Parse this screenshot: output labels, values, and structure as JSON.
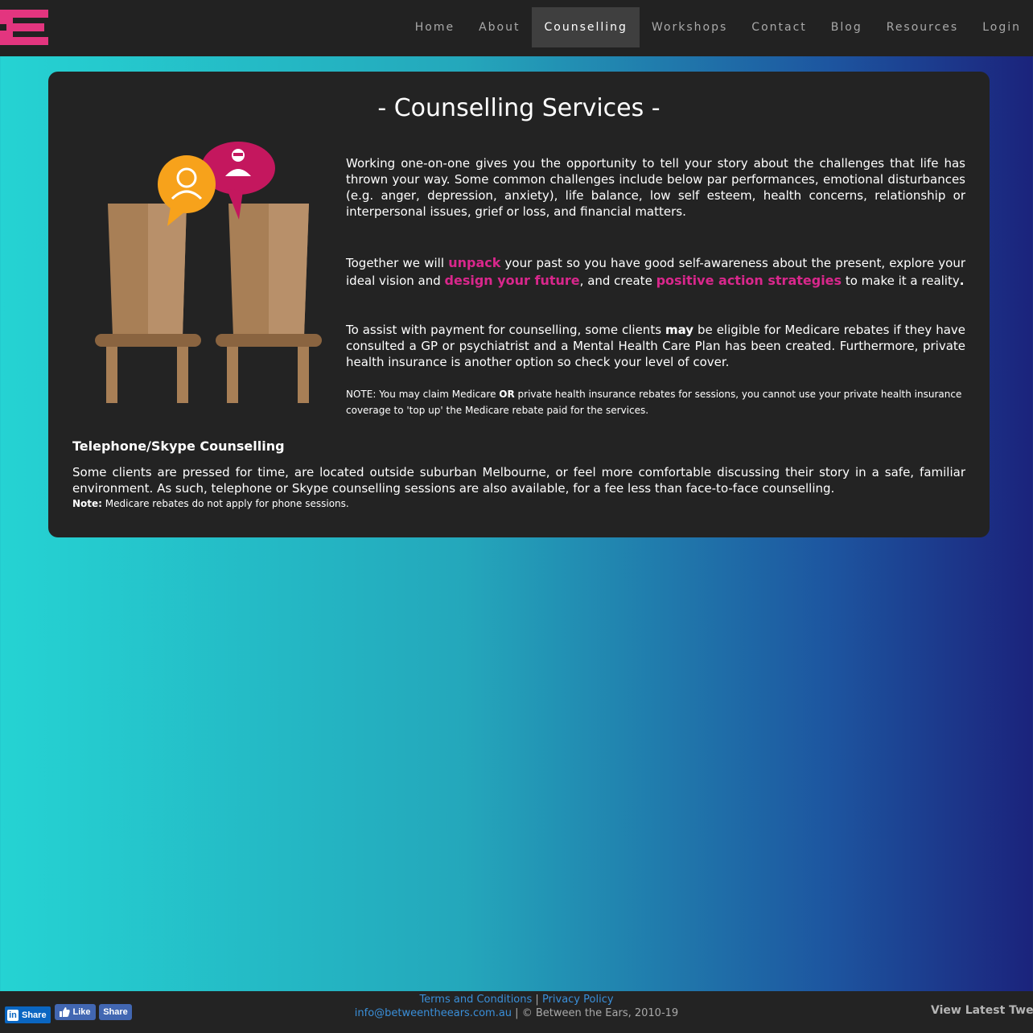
{
  "nav": {
    "items": [
      {
        "label": "Home"
      },
      {
        "label": "About"
      },
      {
        "label": "Counselling"
      },
      {
        "label": "Workshops"
      },
      {
        "label": "Contact"
      },
      {
        "label": "Blog"
      },
      {
        "label": "Resources"
      },
      {
        "label": "Login"
      }
    ],
    "active": "Counselling"
  },
  "colors": {
    "accent": "#d9278c",
    "panel": "#232323",
    "topbar": "#222222"
  },
  "main": {
    "title": "- Counselling Services -",
    "p1": "Working one-on-one gives you the opportunity to tell your story about the challenges that life has thrown your way. Some common challenges include below par performances, emotional disturbances (e.g. anger, depression, anxiety), life balance, low self esteem, health concerns, relationship or interpersonal issues, grief or loss, and financial matters.",
    "p2": {
      "a": "Together we will ",
      "hl1": "unpack",
      "b": " your past so you have good self-awareness about the present, explore your ideal vision and ",
      "hl2": "design your future",
      "c": ", and create ",
      "hl3": "positive action strategies",
      "d": " to make it a reality",
      "e": "."
    },
    "p3": {
      "a": "To assist with payment for counselling, some clients ",
      "bold": "may",
      "b": " be eligible for Medicare rebates if they have consulted a GP or psychiatrist and a Mental Health Care Plan has been created. Furthermore, private health insurance is another option so check your level of cover."
    },
    "note": {
      "a": "NOTE: You may claim Medicare ",
      "bold": "OR",
      "b": " private health insurance rebates for sessions, you cannot use your private health insurance coverage to 'top up' the Medicare rebate paid for the services."
    },
    "section_heading": "Telephone/Skype Counselling",
    "section_body": "Some clients are pressed for time, are located outside suburban Melbourne, or feel more comfortable discussing their story in a safe, familiar environment. As such, telephone or Skype counselling sessions are also available, for a fee less than face-to-face counselling.",
    "section_note_label": "Note:",
    "section_note_text": " Medicare rebates do not apply for phone sessions."
  },
  "footer": {
    "terms": "Terms and Conditions",
    "sep": " | ",
    "privacy": "Privacy Policy",
    "email": "info@betweentheears.com.au",
    "copyright": " | © Between the Ears, 2010-19",
    "tweets": "View Latest Tweets"
  },
  "social": {
    "linkedin_logo": "in",
    "linkedin_label": "Share",
    "fb_like_label": "Like",
    "fb_share_label": "Share"
  }
}
